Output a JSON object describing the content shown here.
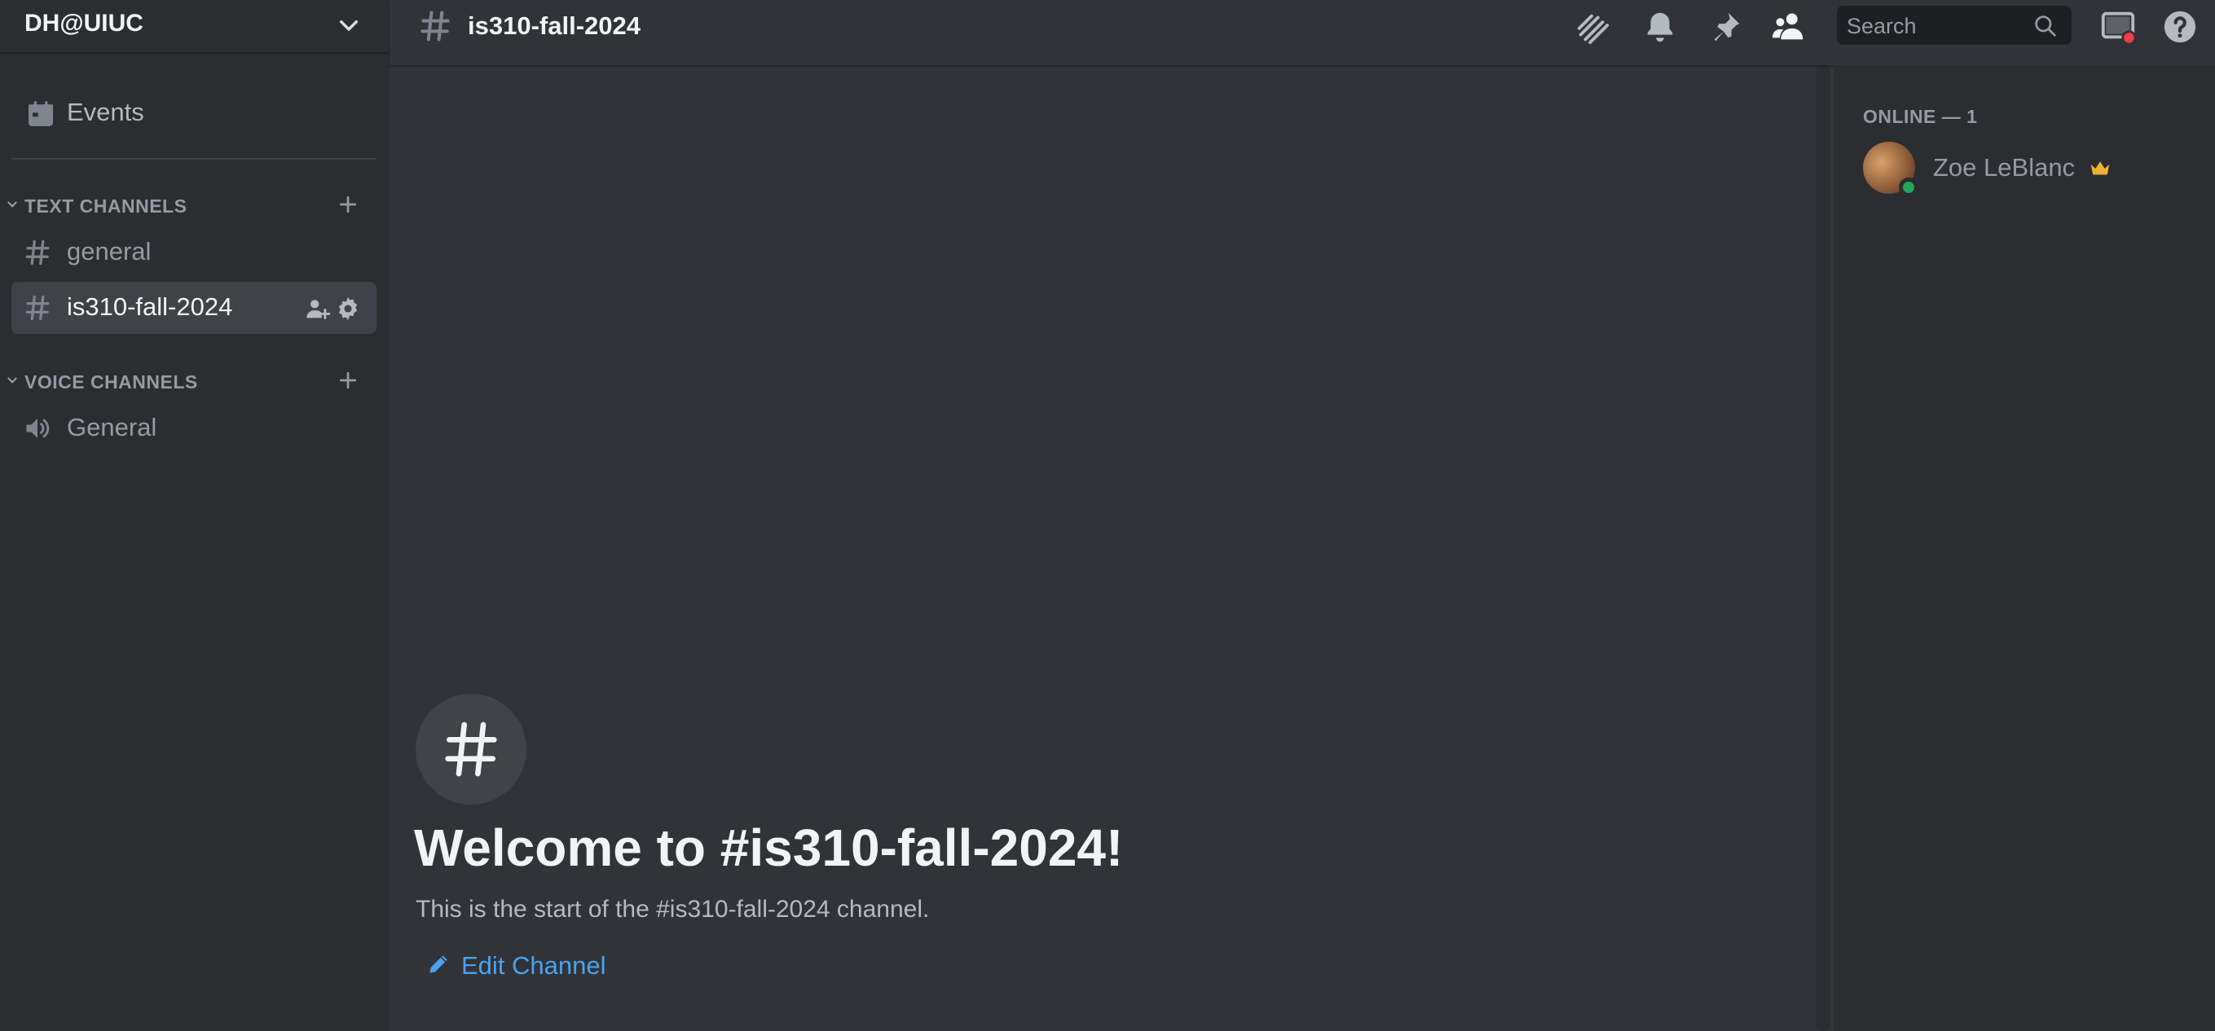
{
  "server": {
    "name": "DH@UIUC"
  },
  "sidebar": {
    "events_label": "Events",
    "text_category": "TEXT CHANNELS",
    "voice_category": "VOICE CHANNELS",
    "text_channels": [
      {
        "label": "general",
        "active": false
      },
      {
        "label": "is310-fall-2024",
        "active": true
      }
    ],
    "voice_channels": [
      {
        "label": "General"
      }
    ]
  },
  "header": {
    "channel_title": "is310-fall-2024",
    "icons": [
      "threads-icon",
      "bell-icon",
      "pin-icon",
      "members-icon",
      "inbox-icon",
      "help-icon"
    ]
  },
  "search": {
    "placeholder": "Search"
  },
  "welcome": {
    "title": "Welcome to #is310-fall-2024!",
    "subtitle": "This is the start of the #is310-fall-2024 channel.",
    "edit_label": "Edit Channel"
  },
  "members": {
    "header": "ONLINE — 1",
    "list": [
      {
        "name": "Zoe LeBlanc",
        "status": "online",
        "owner": true
      }
    ]
  },
  "colors": {
    "background": "#313338",
    "sidebar": "#2b2d31",
    "accent_link": "#4aa3f0",
    "online": "#23a55a",
    "crown": "#f0b232",
    "notification": "#f23f43"
  }
}
